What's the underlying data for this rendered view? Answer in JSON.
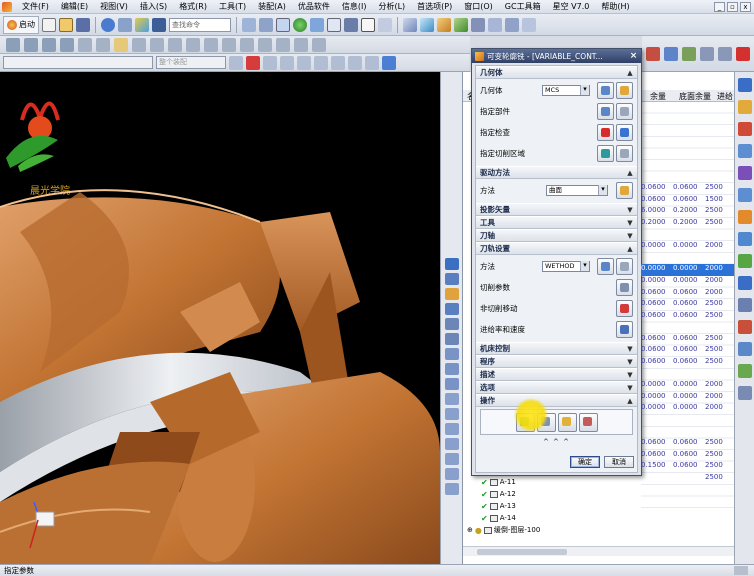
{
  "menu": {
    "items": [
      "文件(F)",
      "编辑(E)",
      "视图(V)",
      "插入(S)",
      "格式(R)",
      "工具(T)",
      "装配(A)",
      "优品软件",
      "信息(I)",
      "分析(L)",
      "首选项(P)",
      "窗口(O)",
      "GC工具箱",
      "星空 V7.0",
      "帮助(H)"
    ]
  },
  "toolbar": {
    "start_label": "启动",
    "search_placeholder": "查找命令"
  },
  "selection_filter": {
    "value": "整个装配"
  },
  "logo": {
    "partial_text": "晨光学院"
  },
  "dialog": {
    "title": "可变轮廓铣 - [VARIABLE_CONT...",
    "close": "×",
    "sections": {
      "geometry": {
        "header": "几何体",
        "geometry_label": "几何体",
        "geometry_value": "MCS",
        "part_label": "指定部件",
        "check_label": "指定检查",
        "cut_area_label": "指定切削区域"
      },
      "drive": {
        "header": "驱动方法",
        "method_label": "方法",
        "method_value": "曲面"
      },
      "projection_vector": {
        "header": "投影矢量"
      },
      "tool": {
        "header": "工具"
      },
      "tool_axis": {
        "header": "刀轴"
      },
      "path_settings": {
        "header": "刀轨设置",
        "method_label": "方法",
        "method_value": "WETHOD",
        "cut_params_label": "切削参数",
        "noncut_label": "非切削移动",
        "feeds_label": "进给率和速度"
      },
      "machine_control": {
        "header": "机床控制"
      },
      "program": {
        "header": "程序"
      },
      "description": {
        "header": "描述"
      },
      "options": {
        "header": "选项"
      },
      "actions": {
        "header": "操作"
      }
    },
    "more": "^ ^ ^",
    "ok_label": "确定",
    "cancel_label": "取消"
  },
  "navigator": {
    "columns": {
      "stock": "余量",
      "floor_stock": "底面余量",
      "feed": "进给"
    },
    "first_col_partial": "名",
    "rows": [
      {
        "stock": "",
        "floor": "",
        "feed": ""
      },
      {
        "stock": "",
        "floor": "",
        "feed": ""
      },
      {
        "stock": "",
        "floor": "",
        "feed": ""
      },
      {
        "stock": "",
        "floor": "",
        "feed": ""
      },
      {
        "stock": "",
        "floor": "",
        "feed": ""
      },
      {
        "stock": "",
        "floor": "",
        "feed": ""
      },
      {
        "stock": "",
        "floor": "",
        "feed": ""
      },
      {
        "stock": "0.0600",
        "floor": "0.0600",
        "feed": "2500"
      },
      {
        "stock": "0.0600",
        "floor": "0.0600",
        "feed": "1500"
      },
      {
        "stock": "6.0000",
        "floor": "0.2000",
        "feed": "2500"
      },
      {
        "stock": "0.2000",
        "floor": "0.2000",
        "feed": "2500"
      },
      {
        "stock": "",
        "floor": "",
        "feed": ""
      },
      {
        "stock": "0.0000",
        "floor": "0.0000",
        "feed": "2000"
      },
      {
        "stock": "",
        "floor": "",
        "feed": ""
      },
      {
        "stock": "0.0000",
        "floor": "0.0000",
        "feed": "2000",
        "selected": true
      },
      {
        "stock": "0.0000",
        "floor": "0.0000",
        "feed": "2000"
      },
      {
        "stock": "0.0600",
        "floor": "0.0600",
        "feed": "2000"
      },
      {
        "stock": "0.0600",
        "floor": "0.0600",
        "feed": "2500"
      },
      {
        "stock": "0.0600",
        "floor": "0.0600",
        "feed": "2500"
      },
      {
        "stock": "",
        "floor": "",
        "feed": ""
      },
      {
        "stock": "0.0600",
        "floor": "0.0600",
        "feed": "2500"
      },
      {
        "stock": "0.0600",
        "floor": "0.0600",
        "feed": "2500"
      },
      {
        "stock": "0.0600",
        "floor": "0.0600",
        "feed": "2500"
      },
      {
        "stock": "",
        "floor": "",
        "feed": ""
      },
      {
        "stock": "0.0000",
        "floor": "0.0000",
        "feed": "2000"
      },
      {
        "stock": "0.0000",
        "floor": "0.0000",
        "feed": "2000"
      },
      {
        "stock": "0.0000",
        "floor": "0.0000",
        "feed": "2000"
      },
      {
        "stock": "",
        "floor": "",
        "feed": ""
      },
      {
        "stock": "",
        "floor": "",
        "feed": ""
      },
      {
        "stock": "0.0600",
        "floor": "0.0600",
        "feed": "2500"
      },
      {
        "stock": "0.0600",
        "floor": "0.0600",
        "feed": "2500"
      },
      {
        "stock": "0.1500",
        "floor": "0.0600",
        "feed": "2500"
      },
      {
        "stock": "",
        "floor": "",
        "feed": "2500"
      }
    ],
    "tree": [
      {
        "name": "A-11"
      },
      {
        "name": "A-12"
      },
      {
        "name": "A-13"
      },
      {
        "name": "A-14"
      }
    ],
    "group_label": "缓倒-图层-100"
  },
  "status": {
    "text": "指定参数"
  },
  "colors": {
    "selection": "#2a72d8",
    "part": "#c9773a",
    "dialog_title": "#2f4066"
  }
}
